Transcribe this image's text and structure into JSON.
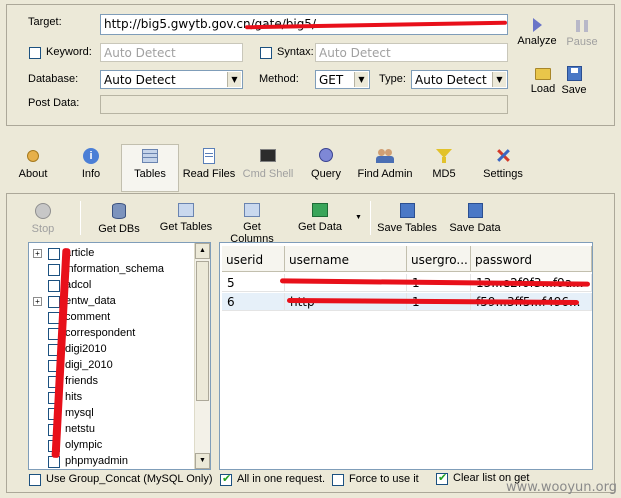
{
  "form": {
    "target_label": "Target:",
    "target_value": "http://big5.gwytb.gov.cn/gate/big5/",
    "keyword_label": "Keyword:",
    "keyword_placeholder": "Auto Detect",
    "syntax_label": "Syntax:",
    "syntax_placeholder": "Auto Detect",
    "database_label": "Database:",
    "database_value": "Auto Detect",
    "method_label": "Method:",
    "method_value": "GET",
    "type_label": "Type:",
    "type_value": "Auto Detect",
    "postdata_label": "Post Data:"
  },
  "side_buttons": {
    "analyze": "Analyze",
    "pause": "Pause",
    "load": "Load",
    "save": "Save"
  },
  "tabs": [
    {
      "label": "About"
    },
    {
      "label": "Info"
    },
    {
      "label": "Tables"
    },
    {
      "label": "Read Files"
    },
    {
      "label": "Cmd Shell"
    },
    {
      "label": "Query"
    },
    {
      "label": "Find Admin"
    },
    {
      "label": "MD5"
    },
    {
      "label": "Settings"
    }
  ],
  "toolbar": {
    "stop": "Stop",
    "get_dbs": "Get DBs",
    "get_tables": "Get Tables",
    "get_columns": "Get Columns",
    "get_data": "Get Data",
    "save_tables": "Save Tables",
    "save_data": "Save Data"
  },
  "tree": [
    {
      "name": "article",
      "expandable": true
    },
    {
      "name": "information_schema",
      "expandable": false
    },
    {
      "name": "adcol",
      "expandable": false
    },
    {
      "name": "entw_data",
      "expandable": true
    },
    {
      "name": "comment",
      "expandable": false
    },
    {
      "name": "correspondent",
      "expandable": false
    },
    {
      "name": "digi2010",
      "expandable": false
    },
    {
      "name": "digi_2010",
      "expandable": false
    },
    {
      "name": "friends",
      "expandable": false
    },
    {
      "name": "hits",
      "expandable": false
    },
    {
      "name": "mysql",
      "expandable": false
    },
    {
      "name": "netstu",
      "expandable": false
    },
    {
      "name": "olympic",
      "expandable": false
    },
    {
      "name": "phpmyadmin",
      "expandable": false
    }
  ],
  "grid": {
    "headers": [
      "userid",
      "username",
      "usergro...",
      "password"
    ],
    "rows": [
      [
        "5",
        "",
        "1",
        "13...e2f0f3...f9a..."
      ],
      [
        "6",
        "http",
        "1",
        "f59...3ff5...f496..."
      ]
    ]
  },
  "footer": {
    "group_concat": "Use Group_Concat (MySQL Only)",
    "all_in_one": "All in one request.",
    "force_use": "Force to use it",
    "clear_list": "Clear list on get"
  },
  "watermark": "www.wooyun.org"
}
